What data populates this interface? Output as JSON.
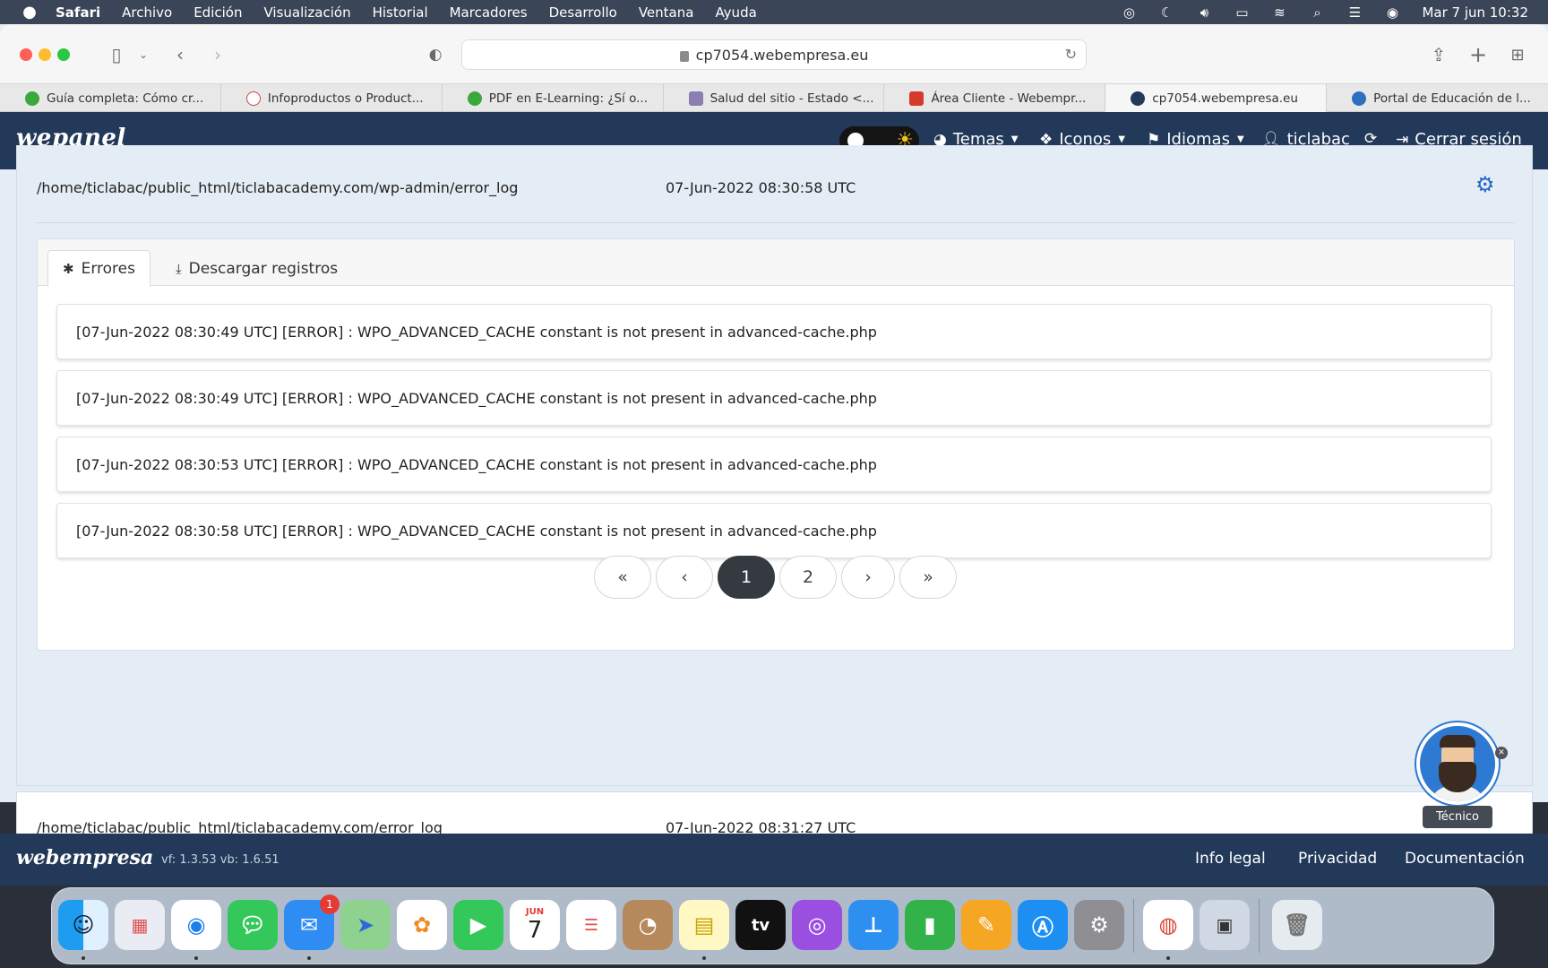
{
  "menubar": {
    "app": "Safari",
    "items": [
      "Archivo",
      "Edición",
      "Visualización",
      "Historial",
      "Marcadores",
      "Desarrollo",
      "Ventana",
      "Ayuda"
    ],
    "clock": "Mar 7 jun  10:32"
  },
  "browser": {
    "url": "cp7054.webempresa.eu",
    "tabs": [
      {
        "label": "Guía completa: Cómo cr...",
        "color": "#3aa83a"
      },
      {
        "label": "Infoproductos o Product...",
        "color": "#e8e8e8"
      },
      {
        "label": "PDF en E-Learning: ¿Sí o...",
        "color": "#3aa83a"
      },
      {
        "label": "Salud del sitio - Estado <...",
        "color": "#8a7fb0"
      },
      {
        "label": "Área Cliente - Webempr...",
        "color": "#d73a2d"
      },
      {
        "label": "cp7054.webempresa.eu",
        "color": "#22395a"
      },
      {
        "label": "Portal de Educación de l...",
        "color": "#2e6fc0"
      }
    ]
  },
  "header": {
    "logo": "wepanel",
    "nav": {
      "themes": "Temas",
      "icons": "Iconos",
      "languages": "Idiomas",
      "user": "ticlabac",
      "logout": "Cerrar sesión"
    }
  },
  "log_file": {
    "path": "/home/ticlabac/public_html/ticlabacademy.com/wp-admin/error_log",
    "date": "07-Jun-2022 08:30:58 UTC",
    "tabs": {
      "errors": "Errores",
      "download": "Descargar registros"
    },
    "entries": [
      "[07-Jun-2022 08:30:49 UTC] [ERROR] : WPO_ADVANCED_CACHE constant is not present in advanced-cache.php",
      "[07-Jun-2022 08:30:49 UTC] [ERROR] : WPO_ADVANCED_CACHE constant is not present in advanced-cache.php",
      "[07-Jun-2022 08:30:53 UTC] [ERROR] : WPO_ADVANCED_CACHE constant is not present in advanced-cache.php",
      "[07-Jun-2022 08:30:58 UTC] [ERROR] : WPO_ADVANCED_CACHE constant is not present in advanced-cache.php"
    ],
    "pagination": {
      "first": "«",
      "prev": "‹",
      "pages": [
        "1",
        "2"
      ],
      "active": "1",
      "next": "›",
      "last": "»"
    }
  },
  "log_file_2": {
    "path": "/home/ticlabac/public_html/ticlabacademy.com/error_log",
    "date": "07-Jun-2022 08:31:27 UTC"
  },
  "support": {
    "label": "Técnico"
  },
  "footer": {
    "logo": "webempresa",
    "version": "vf: 1.3.53 vb: 1.6.51",
    "links": {
      "legal": "Info legal",
      "privacy": "Privacidad",
      "docs": "Documentación"
    }
  },
  "dock": {
    "calendar_month": "JUN",
    "calendar_day": "7",
    "mail_badge": "1",
    "tv_label": "tv"
  },
  "colors": {
    "header_bg": "#22395a",
    "accent": "#2566c8",
    "active_page": "#343a40"
  }
}
